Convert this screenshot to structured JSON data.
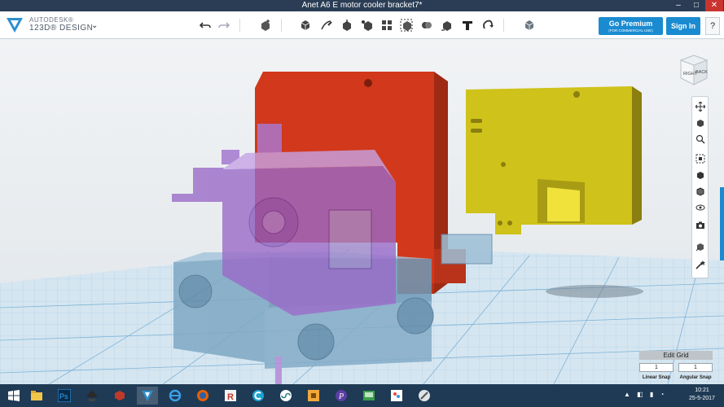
{
  "window": {
    "title": "Anet A6 E motor cooler bracket7*",
    "controls": {
      "minimize": "–",
      "maximize": "□",
      "close": "✕"
    }
  },
  "app": {
    "brand_line1": "AUTODESK®",
    "brand_line2": "123D® DESIGN"
  },
  "toolbar": {
    "tools": [
      "undo-icon",
      "redo-icon",
      "new-shape-icon",
      "primitives-icon",
      "sketch-icon",
      "construct-icon",
      "modify-icon",
      "pattern-icon",
      "grouping-icon",
      "combine-icon",
      "measure-icon",
      "text-icon",
      "snap-icon",
      "material-icon"
    ],
    "premium_label": "Go Premium",
    "premium_sub": "(FOR COMMERCIAL USE)",
    "signin_label": "Sign In",
    "help_label": "?"
  },
  "viewcube": {
    "right_label": "RIGHT",
    "back_label": "BACK"
  },
  "right_tools": [
    "pan-icon",
    "orbit-icon",
    "zoom-icon",
    "fit-icon",
    "view-solid-icon",
    "view-outline-icon",
    "visibility-icon",
    "camera-icon",
    "materials-icon",
    "magic-wand-icon"
  ],
  "grid_panel": {
    "title": "Edit Grid",
    "linear_value": "1",
    "angular_value": "1",
    "linear_label": "Linear Snap",
    "angular_label": "Angular Snap"
  },
  "taskbar": {
    "apps": [
      "windows-start-icon",
      "file-explorer-icon",
      "photoshop-icon",
      "inkscape-icon",
      "3d-app-icon",
      "123d-design-icon",
      "internet-explorer-icon",
      "firefox-icon",
      "repetier-icon",
      "cura-icon",
      "arduino-icon",
      "cpu-app-icon",
      "sketch-app-icon",
      "pronterface-icon",
      "paint-icon",
      "tools-icon"
    ],
    "clock_time": "10:21",
    "clock_date": "25-5-2017"
  },
  "colors": {
    "accent": "#1a8bd1",
    "titlebar": "#2a3d55",
    "taskbar": "#1f3a55",
    "part_red": "#d2381c",
    "part_yellow": "#cfc21a",
    "part_purple": "#9b6bc8",
    "part_blue": "#7fa8c4"
  }
}
